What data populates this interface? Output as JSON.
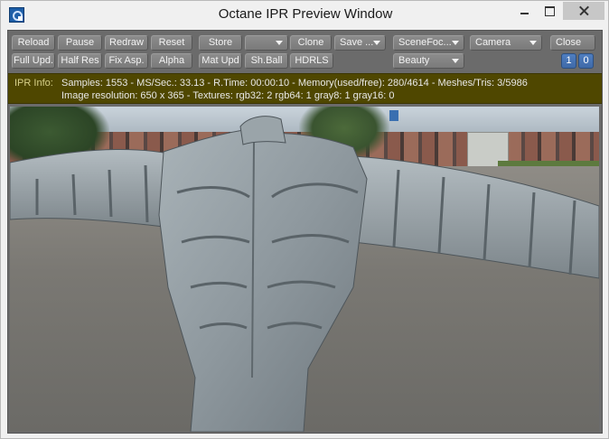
{
  "window": {
    "title": "Octane IPR Preview Window"
  },
  "toolbar": {
    "row1": {
      "reload": "Reload",
      "pause": "Pause",
      "redraw": "Redraw",
      "reset": "Reset",
      "store": "Store",
      "store_select": "",
      "clone": "Clone",
      "save": "Save ...",
      "scene_focus": "SceneFoc...",
      "camera": "Camera",
      "close": "Close"
    },
    "row2": {
      "full_update": "Full Upd.",
      "half_res": "Half Res",
      "fix_aspect": "Fix Asp.",
      "alpha": "Alpha",
      "mat_update": "Mat Upd",
      "sh_ball": "Sh.Ball",
      "hdrls": "HDRLS",
      "render_pass": "Beauty",
      "page_1": "1",
      "page_0": "0"
    }
  },
  "ipr_info": {
    "label": "IPR Info:",
    "line1": "Samples: 1553  -  MS/Sec.: 33.13  -  R.Time: 00:00:10 - Memory(used/free): 280/4614  -  Meshes/Tris: 3/5986",
    "line2": "Image resolution: 650 x 365 - Textures:  rgb32: 2   rgb64: 1   gray8: 1   gray16: 0"
  },
  "icons": {
    "app": "octane-app-icon",
    "minimize": "minimize-icon",
    "maximize": "maximize-icon",
    "close": "close-icon",
    "dropdown": "chevron-down-icon"
  },
  "colors": {
    "panel_bg": "#6b6b6b",
    "info_bg": "#4f4700",
    "button_bg": "#828282",
    "accent_blue": "#4a78b8"
  }
}
